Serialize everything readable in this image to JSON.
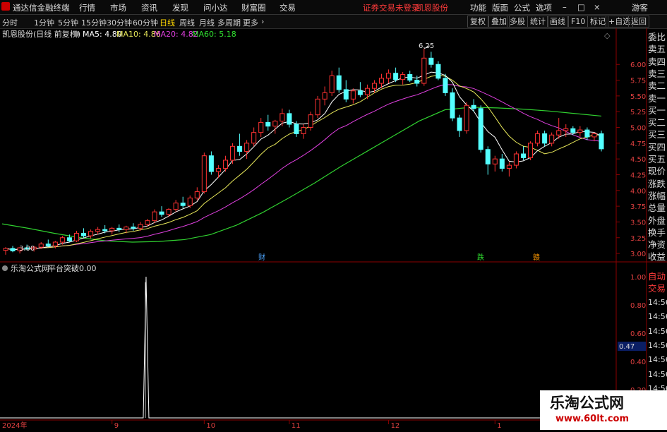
{
  "menubar": {
    "app_title": "通达信金融终端",
    "items": [
      "行情",
      "市场",
      "资讯",
      "发现",
      "问小达",
      "财富圈",
      "交易"
    ],
    "notice": "证券交易未登录",
    "stock_name": "凯恩股份",
    "right_items": [
      "功能",
      "版面",
      "公式",
      "选项"
    ],
    "user": "游客"
  },
  "toolbar": {
    "periods": [
      "分时",
      "1分钟",
      "5分钟",
      "15分钟",
      "30分钟",
      "60分钟",
      "日线",
      "周线",
      "月线",
      "多周期",
      "更多"
    ],
    "active_period": "日线",
    "buttons": [
      "复权",
      "叠加",
      "多股",
      "统计",
      "画线",
      "F10",
      "标记",
      "+自选",
      "返回"
    ]
  },
  "main_chart": {
    "title": "凯恩股份(日线 前复权)",
    "ma_labels": [
      {
        "text": "MA5: 4.80",
        "color": "#ffffff"
      },
      {
        "text": "MA10: 4.86",
        "color": "#e8e85a"
      },
      {
        "text": "MA20: 4.82",
        "color": "#e040e0"
      },
      {
        "text": "MA60: 5.18",
        "color": "#30e030"
      }
    ],
    "high_label": "6.25",
    "low_label": "3.00",
    "event_markers": [
      {
        "text": "财",
        "color": "#4da6ff"
      },
      {
        "text": "跌",
        "color": "#30e030"
      },
      {
        "text": "赣",
        "color": "#ff9900"
      }
    ],
    "y_ticks": [
      "6.00",
      "5.75",
      "5.50",
      "5.25",
      "5.00",
      "4.75",
      "4.50",
      "4.25",
      "4.00",
      "3.75",
      "3.50",
      "3.25",
      "3.00"
    ]
  },
  "indicator_chart": {
    "title": "乐淘公式网",
    "indicator_name": "平台突破",
    "value": "0.00",
    "y_ticks": [
      "1.00",
      "0.80",
      "0.60",
      "0.40",
      "0.20"
    ],
    "current_value": "0.47"
  },
  "x_axis_labels": [
    "2024年",
    "9",
    "10",
    "11",
    "12",
    "1"
  ],
  "side_panel": {
    "labels": [
      "委比",
      "卖五",
      "卖四",
      "卖三",
      "卖二",
      "卖一",
      "买一",
      "买二",
      "买三",
      "买四",
      "买五",
      "现价",
      "涨跌",
      "涨幅",
      "总量",
      "外盘",
      "换手",
      "净资",
      "收益"
    ],
    "lower_labels": [
      "自动",
      "交易"
    ],
    "times": [
      "14:56",
      "14:56",
      "14:56",
      "14:56",
      "14:56",
      "14:56",
      "14:56",
      "14:56",
      "14:56"
    ]
  },
  "watermark": {
    "line1": "乐淘公式网",
    "line2": "www.60lt.com"
  },
  "colors": {
    "up": "#ff3232",
    "down": "#54ffff",
    "grid": "#8b0000",
    "axis_text": "#e04040"
  },
  "chart_data": {
    "type": "candlestick",
    "price_range": [
      2.9,
      6.35
    ],
    "candles": [
      [
        3.05,
        3.1,
        2.98,
        3.08
      ],
      [
        3.08,
        3.12,
        3.02,
        3.04
      ],
      [
        3.04,
        3.1,
        3.0,
        3.09
      ],
      [
        3.09,
        3.14,
        3.05,
        3.07
      ],
      [
        3.07,
        3.12,
        3.03,
        3.1
      ],
      [
        3.1,
        3.18,
        3.07,
        3.15
      ],
      [
        3.15,
        3.22,
        3.1,
        3.12
      ],
      [
        3.12,
        3.2,
        3.08,
        3.18
      ],
      [
        3.18,
        3.28,
        3.14,
        3.25
      ],
      [
        3.25,
        3.3,
        3.18,
        3.2
      ],
      [
        3.2,
        3.36,
        3.18,
        3.32
      ],
      [
        3.32,
        3.4,
        3.25,
        3.28
      ],
      [
        3.28,
        3.38,
        3.24,
        3.35
      ],
      [
        3.35,
        3.42,
        3.3,
        3.38
      ],
      [
        3.38,
        3.45,
        3.32,
        3.36
      ],
      [
        3.36,
        3.42,
        3.3,
        3.4
      ],
      [
        3.4,
        3.46,
        3.34,
        3.38
      ],
      [
        3.38,
        3.44,
        3.32,
        3.42
      ],
      [
        3.42,
        3.48,
        3.36,
        3.4
      ],
      [
        3.4,
        3.5,
        3.36,
        3.46
      ],
      [
        3.46,
        3.55,
        3.42,
        3.52
      ],
      [
        3.52,
        3.7,
        3.48,
        3.66
      ],
      [
        3.66,
        3.75,
        3.58,
        3.62
      ],
      [
        3.62,
        3.72,
        3.58,
        3.7
      ],
      [
        3.7,
        3.85,
        3.66,
        3.8
      ],
      [
        3.8,
        3.9,
        3.72,
        3.76
      ],
      [
        3.76,
        3.92,
        3.72,
        3.88
      ],
      [
        3.88,
        4.05,
        3.84,
        3.98
      ],
      [
        3.98,
        4.6,
        3.95,
        4.55
      ],
      [
        4.55,
        4.62,
        4.25,
        4.3
      ],
      [
        4.3,
        4.4,
        4.2,
        4.35
      ],
      [
        4.35,
        4.55,
        4.3,
        4.48
      ],
      [
        4.48,
        4.75,
        4.42,
        4.7
      ],
      [
        4.7,
        4.9,
        4.55,
        4.62
      ],
      [
        4.62,
        4.8,
        4.5,
        4.75
      ],
      [
        4.75,
        5.0,
        4.7,
        4.92
      ],
      [
        4.92,
        5.15,
        4.85,
        5.08
      ],
      [
        5.08,
        5.2,
        4.95,
        5.02
      ],
      [
        5.02,
        5.12,
        4.9,
        5.1
      ],
      [
        5.1,
        5.3,
        5.02,
        5.22
      ],
      [
        5.22,
        5.28,
        5.0,
        5.05
      ],
      [
        5.05,
        5.1,
        4.85,
        4.9
      ],
      [
        4.9,
        5.05,
        4.82,
        5.0
      ],
      [
        5.0,
        5.25,
        4.95,
        5.2
      ],
      [
        5.2,
        5.5,
        5.15,
        5.45
      ],
      [
        5.45,
        5.65,
        5.35,
        5.55
      ],
      [
        5.55,
        5.9,
        5.5,
        5.82
      ],
      [
        5.82,
        5.95,
        5.55,
        5.6
      ],
      [
        5.6,
        5.75,
        5.4,
        5.45
      ],
      [
        5.45,
        5.62,
        5.38,
        5.58
      ],
      [
        5.58,
        5.72,
        5.48,
        5.52
      ],
      [
        5.52,
        5.68,
        5.45,
        5.62
      ],
      [
        5.62,
        5.75,
        5.55,
        5.7
      ],
      [
        5.7,
        5.85,
        5.62,
        5.78
      ],
      [
        5.78,
        5.92,
        5.7,
        5.86
      ],
      [
        5.86,
        5.95,
        5.72,
        5.76
      ],
      [
        5.76,
        5.88,
        5.68,
        5.84
      ],
      [
        5.84,
        5.9,
        5.72,
        5.75
      ],
      [
        5.75,
        5.82,
        5.65,
        5.7
      ],
      [
        5.7,
        6.25,
        5.66,
        6.1
      ],
      [
        6.1,
        6.2,
        5.95,
        6.0
      ],
      [
        6.0,
        6.05,
        5.75,
        5.78
      ],
      [
        5.78,
        5.85,
        5.5,
        5.55
      ],
      [
        5.55,
        5.62,
        5.1,
        5.15
      ],
      [
        5.15,
        5.2,
        4.85,
        4.95
      ],
      [
        4.95,
        5.4,
        4.9,
        5.35
      ],
      [
        5.35,
        5.45,
        5.25,
        5.3
      ],
      [
        5.3,
        5.35,
        4.6,
        4.65
      ],
      [
        4.65,
        4.7,
        4.25,
        4.42
      ],
      [
        4.42,
        4.55,
        4.3,
        4.5
      ],
      [
        4.5,
        4.58,
        4.3,
        4.35
      ],
      [
        4.35,
        4.45,
        4.22,
        4.4
      ],
      [
        4.4,
        4.62,
        4.35,
        4.58
      ],
      [
        4.58,
        4.7,
        4.48,
        4.52
      ],
      [
        4.52,
        4.78,
        4.48,
        4.75
      ],
      [
        4.75,
        4.95,
        4.7,
        4.9
      ],
      [
        4.9,
        4.95,
        4.7,
        4.75
      ],
      [
        4.75,
        4.92,
        4.7,
        4.88
      ],
      [
        4.88,
        5.15,
        4.82,
        4.95
      ],
      [
        4.95,
        5.05,
        4.85,
        4.98
      ],
      [
        4.98,
        5.02,
        4.88,
        4.92
      ],
      [
        4.92,
        5.02,
        4.85,
        4.96
      ],
      [
        4.96,
        5.0,
        4.8,
        4.85
      ],
      [
        4.85,
        4.92,
        4.78,
        4.9
      ],
      [
        4.9,
        4.95,
        4.62,
        4.66
      ]
    ],
    "ma60": [
      3.47,
      3.4,
      3.32,
      3.25,
      3.2,
      3.18,
      3.19,
      3.22,
      3.3,
      3.45,
      3.65,
      3.88,
      4.12,
      4.38,
      4.62,
      4.86,
      5.1,
      5.28,
      5.32,
      5.31,
      5.29,
      5.26,
      5.22,
      5.18
    ],
    "indicator_peak_index": 20,
    "indicator_peak_value": 1.0
  }
}
